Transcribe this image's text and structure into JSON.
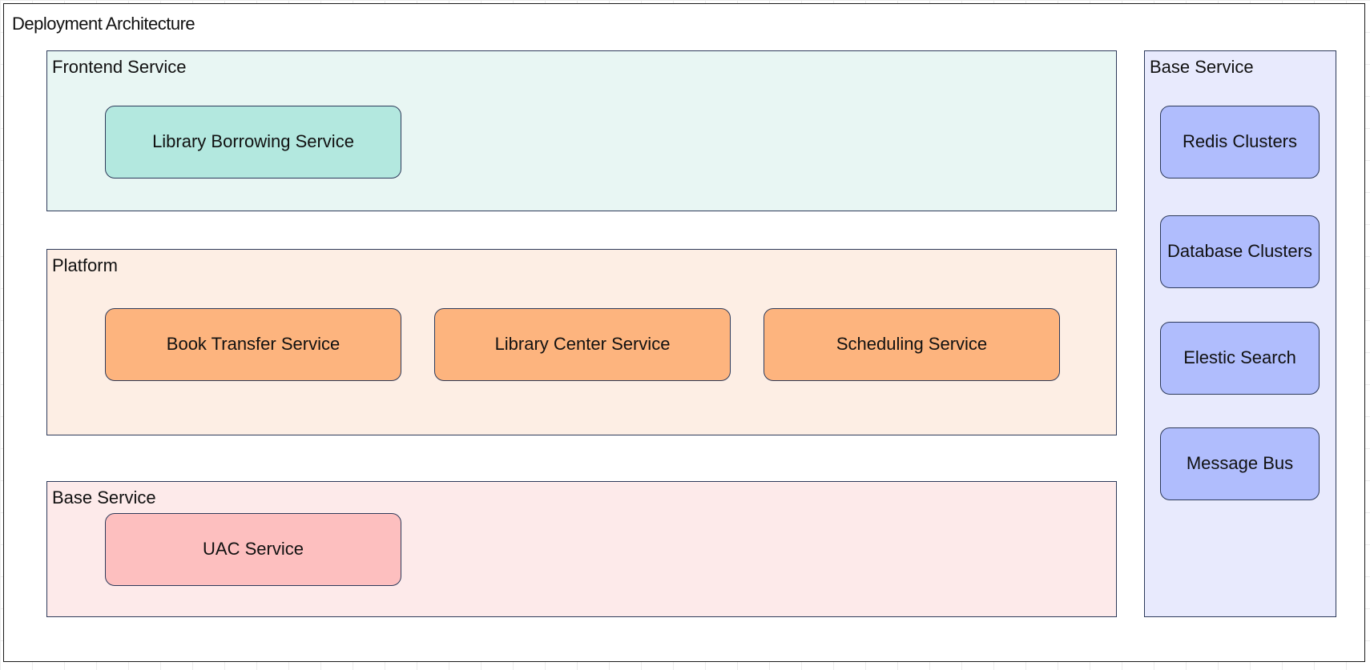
{
  "diagram": {
    "title": "Deployment Architecture",
    "colors": {
      "frontend_group_bg": "#e8f6f3",
      "frontend_node_bg": "#b3e8df",
      "platform_group_bg": "#fdeee4",
      "platform_node_bg": "#fdb47e",
      "base_group_bg": "#fdeaea",
      "base_node_bg": "#fdbfbf",
      "infra_group_bg": "#e8eafd",
      "infra_node_bg": "#b0bdfd",
      "border": "#2d3a5a"
    },
    "groups": {
      "frontend": {
        "title": "Frontend Service",
        "nodes": [
          "Library Borrowing Service"
        ]
      },
      "platform": {
        "title": "Platform",
        "nodes": [
          "Book Transfer Service",
          "Library Center Service",
          "Scheduling Service"
        ]
      },
      "base": {
        "title": "Base Service",
        "nodes": [
          "UAC Service"
        ]
      },
      "base_right": {
        "title": "Base Service",
        "nodes": [
          "Redis Clusters",
          "Database Clusters",
          "Elestic Search",
          "Message Bus"
        ]
      }
    }
  }
}
